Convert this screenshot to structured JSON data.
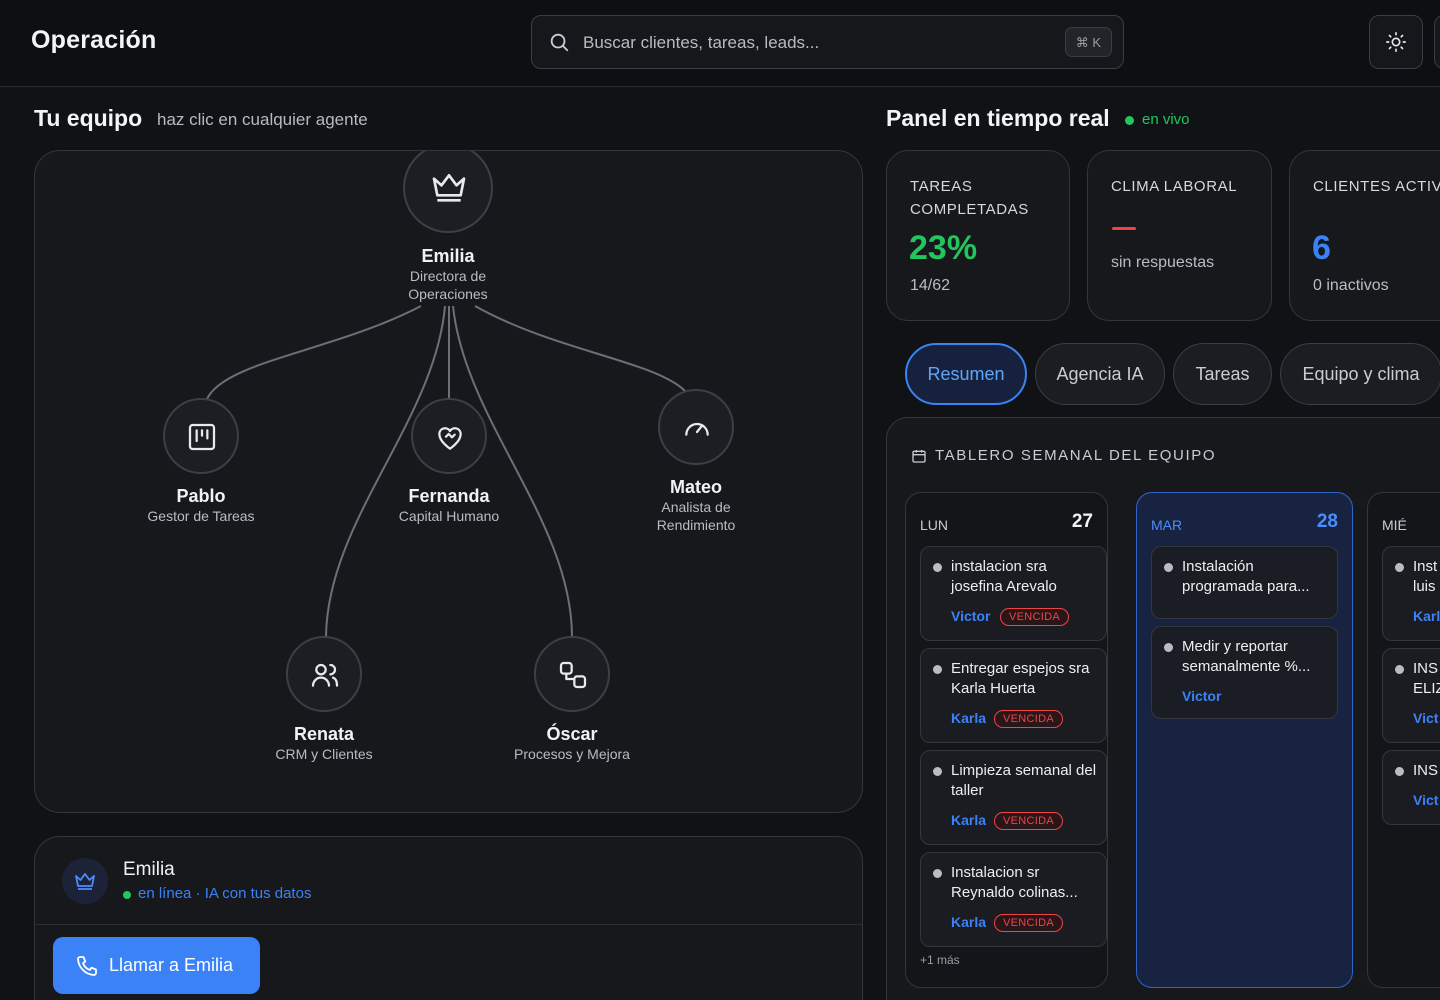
{
  "header": {
    "title": "Operación",
    "search_placeholder": "Buscar clientes, tareas, leads...",
    "shortcut": "⌘ K"
  },
  "team": {
    "title": "Tu equipo",
    "subtitle": "haz clic en cualquier agente",
    "nodes": [
      {
        "name": "Emilia",
        "role": "Directora de Operaciones",
        "icon": "crown-icon"
      },
      {
        "name": "Pablo",
        "role": "Gestor de Tareas",
        "icon": "kanban-icon"
      },
      {
        "name": "Fernanda",
        "role": "Capital Humano",
        "icon": "heart-handshake-icon"
      },
      {
        "name": "Mateo",
        "role": "Analista de Rendimiento",
        "icon": "gauge-icon"
      },
      {
        "name": "Renata",
        "role": "CRM y Clientes",
        "icon": "users-icon"
      },
      {
        "name": "Óscar",
        "role": "Procesos y Mejora",
        "icon": "workflow-icon"
      }
    ]
  },
  "agent": {
    "name": "Emilia",
    "status": "en línea · IA con tus datos",
    "call_label": "Llamar a Emilia"
  },
  "panel": {
    "title": "Panel en tiempo real",
    "live": "en vivo",
    "stats": [
      {
        "label": "TAREAS COMPLETADAS",
        "value": "23%",
        "sub": "14/62"
      },
      {
        "label": "CLIMA LABORAL",
        "value": "—",
        "sub": "sin respuestas"
      },
      {
        "label": "CLIENTES ACTIVOS",
        "value": "6",
        "sub": "0 inactivos"
      }
    ],
    "tabs": [
      "Resumen",
      "Agencia IA",
      "Tareas",
      "Equipo y clima"
    ]
  },
  "board": {
    "title": "TABLERO SEMANAL DEL EQUIPO",
    "days": [
      {
        "name": "LUN",
        "num": "27",
        "tasks": [
          {
            "title": "instalacion sra josefina Arevalo",
            "user": "Victor",
            "badge": "VENCIDA"
          },
          {
            "title": "Entregar espejos sra Karla Huerta",
            "user": "Karla",
            "badge": "VENCIDA"
          },
          {
            "title": "Limpieza semanal del taller",
            "user": "Karla",
            "badge": "VENCIDA"
          },
          {
            "title": "Instalacion sr Reynaldo colinas...",
            "user": "Karla",
            "badge": "VENCIDA"
          }
        ],
        "more": "+1 más"
      },
      {
        "name": "MAR",
        "num": "28",
        "tasks": [
          {
            "title": "Instalación programada para...",
            "user": "",
            "badge": ""
          },
          {
            "title": "Medir y reportar semanalmente %...",
            "user": "Victor",
            "badge": ""
          }
        ]
      },
      {
        "name": "MIÉ",
        "num": "",
        "tasks": [
          {
            "title": "Inst luis",
            "user": "Karl",
            "badge": ""
          },
          {
            "title": "INS ELIZ",
            "user": "Vict",
            "badge": ""
          },
          {
            "title": "INS",
            "user": "Vict",
            "badge": ""
          }
        ]
      }
    ]
  },
  "colors": {
    "accent": "#3b82f6",
    "success": "#22c55e",
    "danger": "#ef4444",
    "background": "#111215"
  }
}
